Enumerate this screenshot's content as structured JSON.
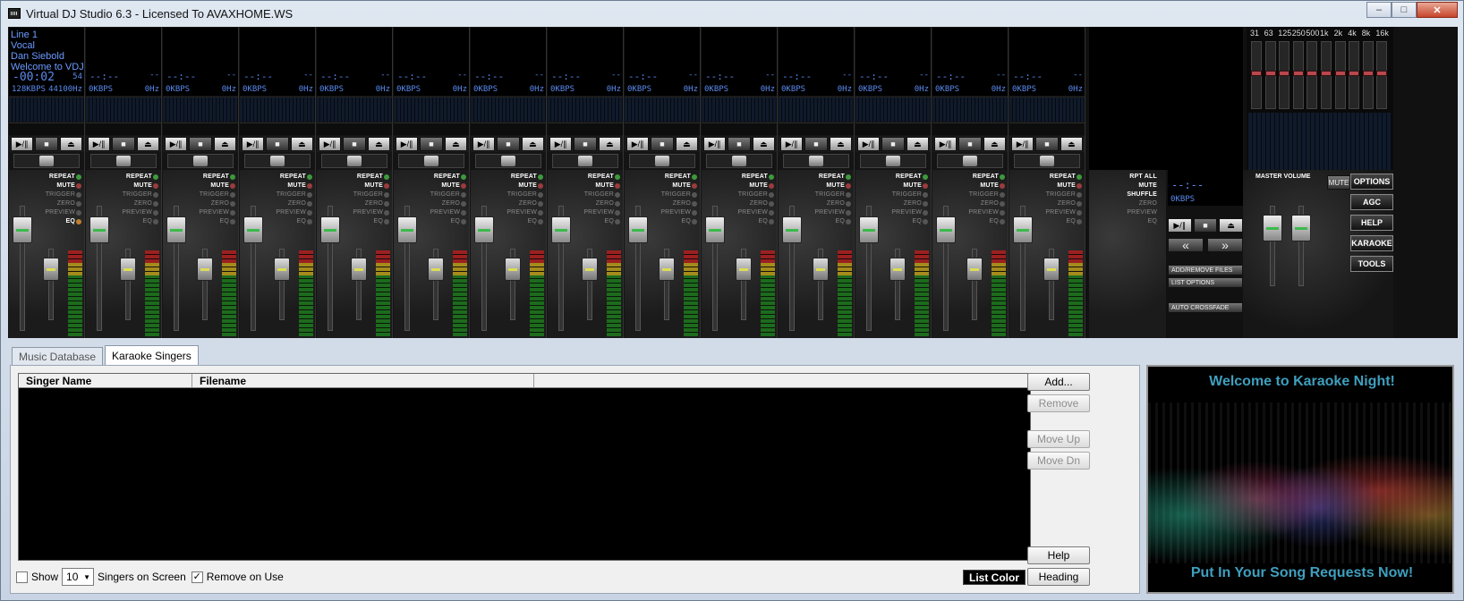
{
  "window": {
    "title": "Virtual DJ Studio 6.3 - Licensed To AVAXHOME.WS",
    "min": "–",
    "max": "□",
    "close": "✕"
  },
  "deck1": {
    "l1": "Line 1",
    "l2": "Vocal",
    "l3": "Dan Siebold",
    "l4": "Welcome to VDJ",
    "time": "-00:02",
    "sec": "54",
    "kbps": "128KBPS",
    "hz": "44100Hz"
  },
  "deck": {
    "time": "--:--",
    "sec": "--",
    "kbps": "0KBPS",
    "hz": "0Hz"
  },
  "flags": {
    "repeat": "REPEAT",
    "mute": "MUTE",
    "trigger": "TRIGGER",
    "zero": "ZERO",
    "preview": "PREVIEW",
    "eq": "EQ"
  },
  "controls": {
    "play": "▶/∥",
    "stop": "■",
    "eject": "⏏"
  },
  "playlist": {
    "rptall": "RPT ALL",
    "mute": "MUTE",
    "shuffle": "SHUFFLE",
    "zero": "ZERO",
    "preview": "PREVIEW",
    "eq": "EQ",
    "time": "--:--",
    "kbps": "0KBPS",
    "prev": "«",
    "next": "»",
    "add": "ADD/REMOVE FILES",
    "opts": "LIST OPTIONS",
    "auto": "AUTO CROSSFADE"
  },
  "eq": {
    "bands": [
      "31",
      "63",
      "125",
      "250",
      "500",
      "1k",
      "2k",
      "4k",
      "8k",
      "16k"
    ]
  },
  "master": {
    "label": "MASTER VOLUME",
    "mute": "MUTE"
  },
  "right_buttons": {
    "options": "OPTIONS",
    "agc": "AGC",
    "help": "HELP",
    "karaoke": "KARAOKE",
    "tools": "TOOLS"
  },
  "tabs": {
    "music": "Music Database",
    "karaoke": "Karaoke Singers"
  },
  "list": {
    "col1": "Singer Name",
    "col2": "Filename"
  },
  "buttons": {
    "add": "Add...",
    "remove": "Remove",
    "up": "Move Up",
    "down": "Move Dn",
    "help": "Help",
    "heading": "Heading"
  },
  "footer": {
    "show": "Show",
    "count": "10",
    "singers": "Singers on Screen",
    "remove_check": "✓",
    "remove_on_use": "Remove on Use",
    "list_color": "List Color"
  },
  "stage": {
    "top": "Welcome to Karaoke Night!",
    "bottom": "Put In Your Song Requests Now!"
  }
}
